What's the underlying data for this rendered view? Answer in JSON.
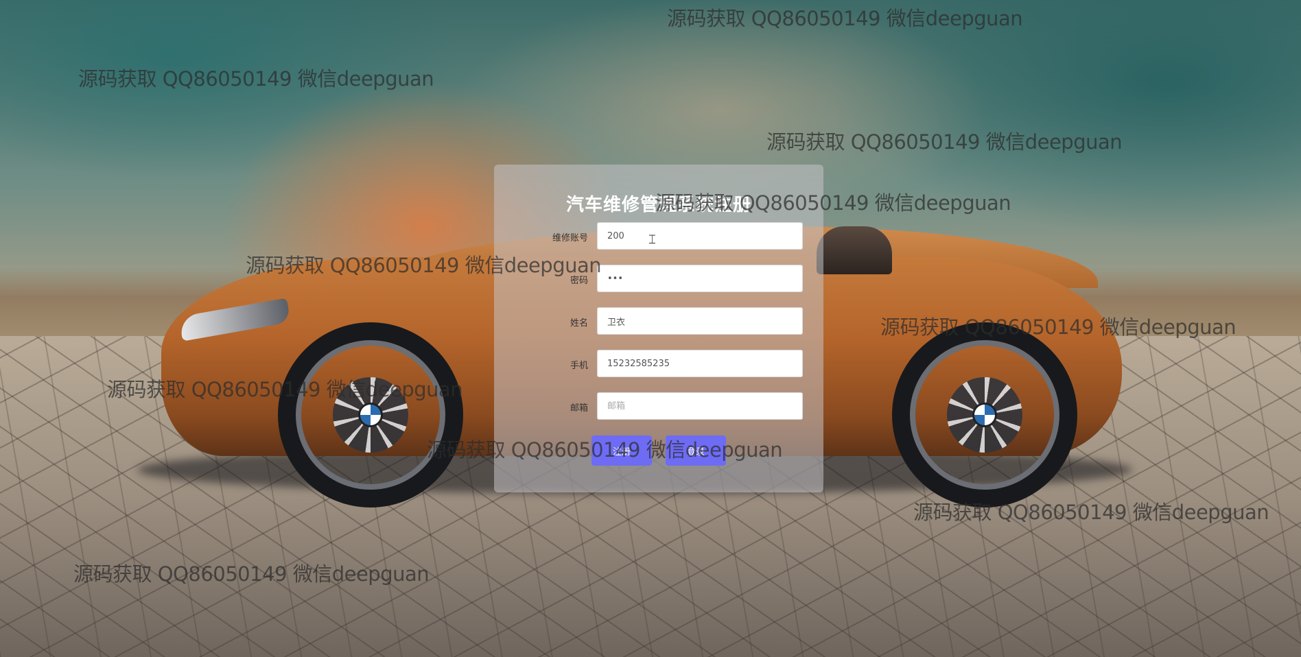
{
  "form": {
    "title": "汽车维修管理系统注册",
    "fields": [
      {
        "label": "维修账号",
        "value": "200",
        "placeholder": "",
        "type": "text"
      },
      {
        "label": "密码",
        "value": "•••",
        "placeholder": "",
        "type": "text"
      },
      {
        "label": "姓名",
        "value": "卫衣",
        "placeholder": "",
        "type": "text"
      },
      {
        "label": "手机",
        "value": "15232585235",
        "placeholder": "",
        "type": "text"
      },
      {
        "label": "邮箱",
        "value": "",
        "placeholder": "邮箱",
        "type": "text"
      }
    ],
    "buttons": {
      "register": "注册",
      "login": "登录"
    }
  },
  "watermark": {
    "text": "源码获取 QQ86050149 微信deepguan"
  },
  "colors": {
    "button": "#6e6cf5",
    "title": "#ffffff",
    "panel": "rgba(196,194,198,0.55)"
  },
  "icons": {
    "cursor": "text-cursor-icon"
  }
}
